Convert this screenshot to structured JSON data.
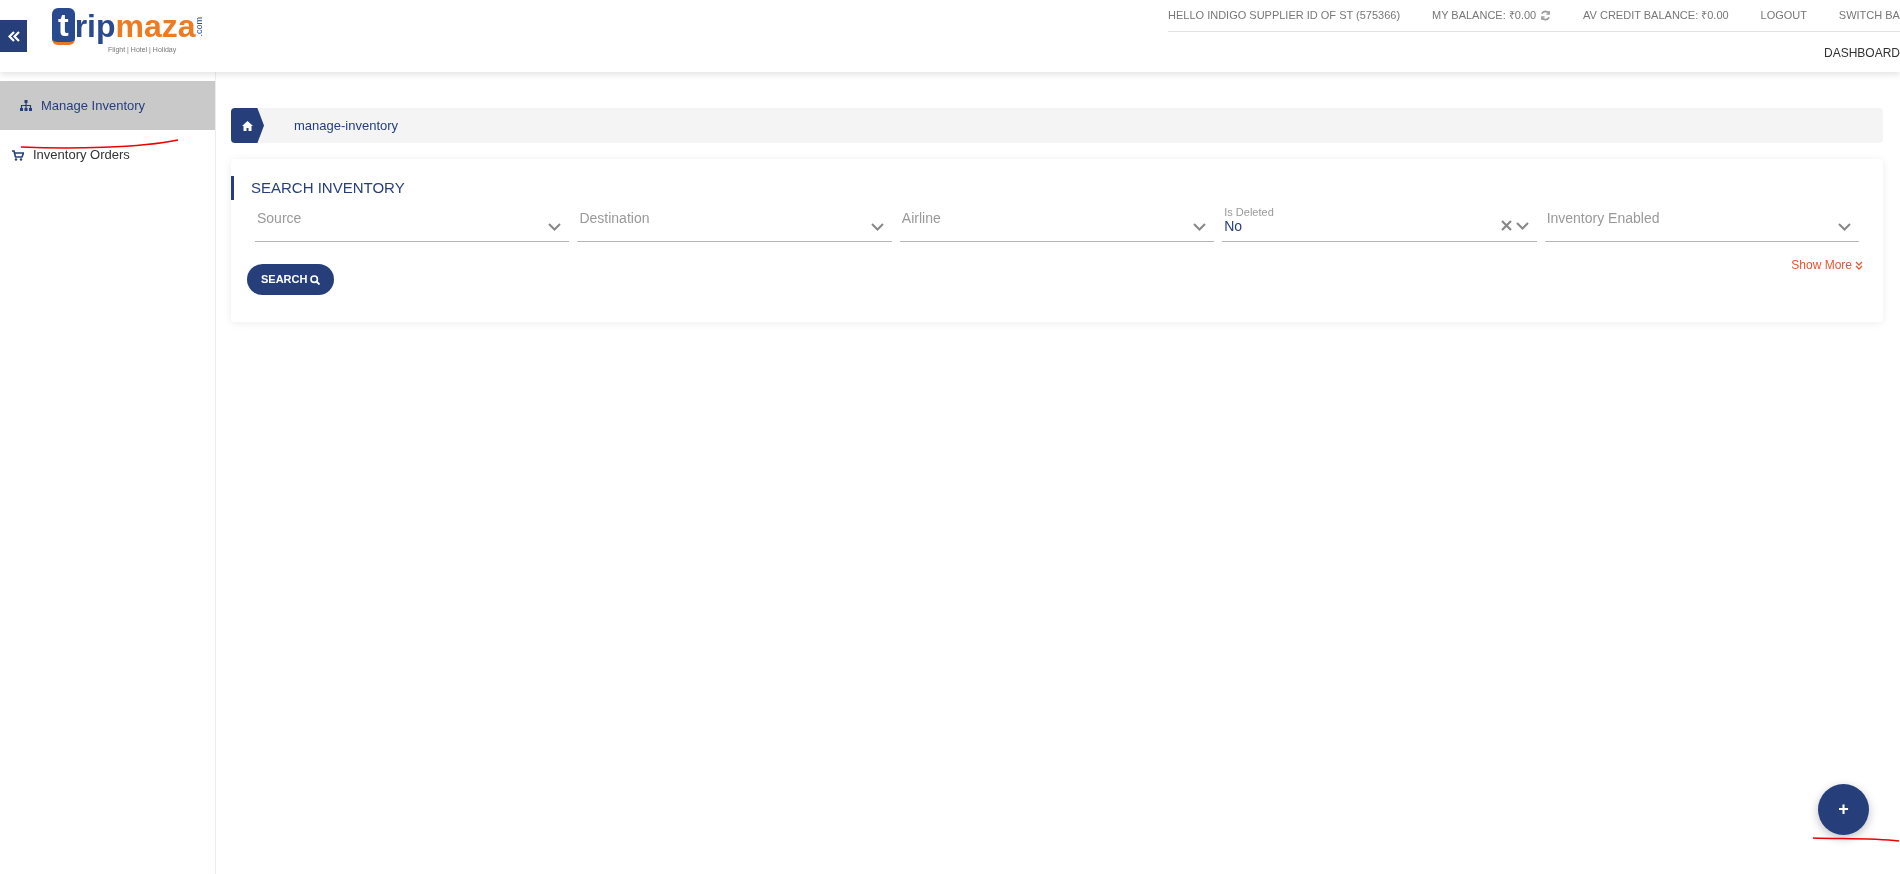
{
  "header": {
    "logo": {
      "letter": "t",
      "part1": "rip",
      "part2": "maza",
      "domain": ".com",
      "tagline": "Flight | Hotel | Holiday"
    },
    "top_links": [
      {
        "text": "HELLO INDIGO SUPPLIER ID OF ST (575366)"
      },
      {
        "text": "MY BALANCE: ₹0.00",
        "refresh": true
      },
      {
        "text": "AV CREDIT BALANCE: ₹0.00"
      },
      {
        "text": "LOGOUT"
      },
      {
        "text": "SWITCH BA"
      }
    ],
    "nav": [
      "DASHBOARD"
    ]
  },
  "sidebar": {
    "items": [
      {
        "label": "Manage Inventory",
        "selected": true
      },
      {
        "label": "Inventory Orders",
        "selected": false
      }
    ]
  },
  "breadcrumb": {
    "items": [
      "manage-inventory"
    ]
  },
  "search_panel": {
    "title": "SEARCH INVENTORY",
    "fields": [
      {
        "placeholder": "Source"
      },
      {
        "placeholder": "Destination"
      },
      {
        "placeholder": "Airline"
      },
      {
        "label": "Is Deleted",
        "value": "No",
        "clearable": true
      },
      {
        "placeholder": "Inventory Enabled"
      }
    ],
    "search_button": "SEARCH",
    "show_more": "Show More"
  },
  "fab": {
    "label": "+"
  }
}
